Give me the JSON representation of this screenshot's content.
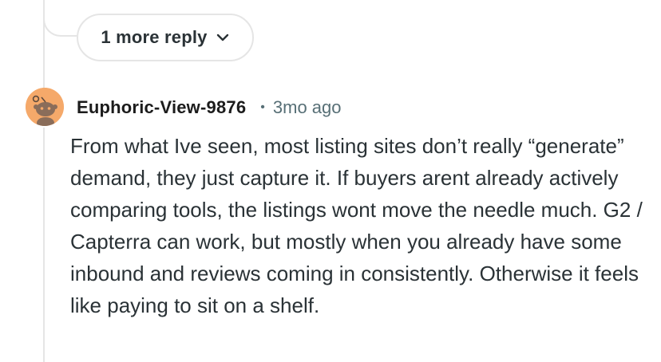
{
  "thread": {
    "more_replies_label": "1 more reply"
  },
  "comment": {
    "username": "Euphoric-View-9876",
    "separator": "•",
    "timestamp": "3mo ago",
    "body": "From what Ive seen, most listing sites don’t really “generate” demand, they just capture it. If buyers arent already actively comparing tools, the listings wont move the needle much. G2 / Capterra can work, but mostly when you already have some inbound and reviews coming in consistently. Otherwise it feels like paying to sit on a shelf."
  },
  "icons": {
    "avatar": "snoo-avatar-icon",
    "chevron": "chevron-down-icon"
  },
  "colors": {
    "avatar_bg": "#f5a96a",
    "thread_line": "#e5e5e5",
    "meta_text": "#576f76"
  }
}
